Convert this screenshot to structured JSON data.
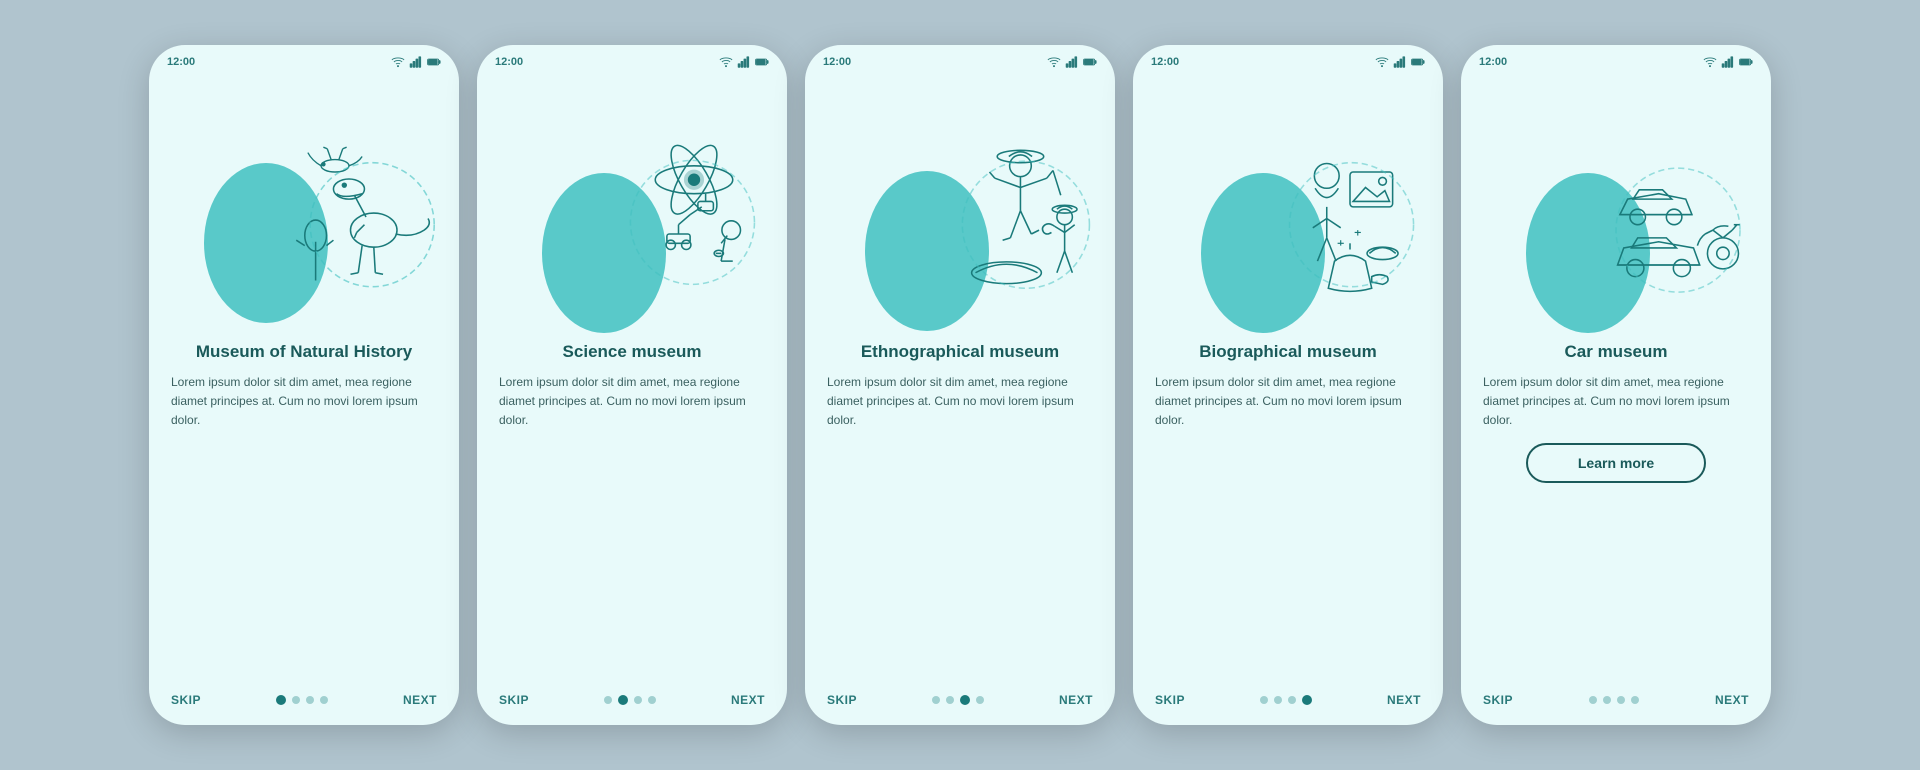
{
  "phones": [
    {
      "id": "natural-history",
      "title": "Museum of Natural History",
      "body": "Lorem ipsum dolor sit dim amet, mea regione diamet principes at. Cum no movi lorem ipsum dolor.",
      "active_dot": 0,
      "skip_label": "SKIP",
      "next_label": "NEXT",
      "time": "12:00",
      "show_learn_more": false
    },
    {
      "id": "science",
      "title": "Science museum",
      "body": "Lorem ipsum dolor sit dim amet, mea regione diamet principes at. Cum no movi lorem ipsum dolor.",
      "active_dot": 1,
      "skip_label": "SKIP",
      "next_label": "NEXT",
      "time": "12:00",
      "show_learn_more": false
    },
    {
      "id": "ethnographical",
      "title": "Ethnographical museum",
      "body": "Lorem ipsum dolor sit dim amet, mea regione diamet principes at. Cum no movi lorem ipsum dolor.",
      "active_dot": 2,
      "skip_label": "SKIP",
      "next_label": "NEXT",
      "time": "12:00",
      "show_learn_more": false
    },
    {
      "id": "biographical",
      "title": "Biographical museum",
      "body": "Lorem ipsum dolor sit dim amet, mea regione diamet principes at. Cum no movi lorem ipsum dolor.",
      "active_dot": 3,
      "skip_label": "SKIP",
      "next_label": "NEXT",
      "time": "12:00",
      "show_learn_more": false
    },
    {
      "id": "car",
      "title": "Car museum",
      "body": "Lorem ipsum dolor sit dim amet, mea regione diamet principes at. Cum no movi lorem ipsum dolor.",
      "active_dot": 4,
      "skip_label": "SKIP",
      "next_label": "NEXT",
      "time": "12:00",
      "show_learn_more": true,
      "learn_more_label": "Learn more"
    }
  ],
  "dots_count": 4
}
